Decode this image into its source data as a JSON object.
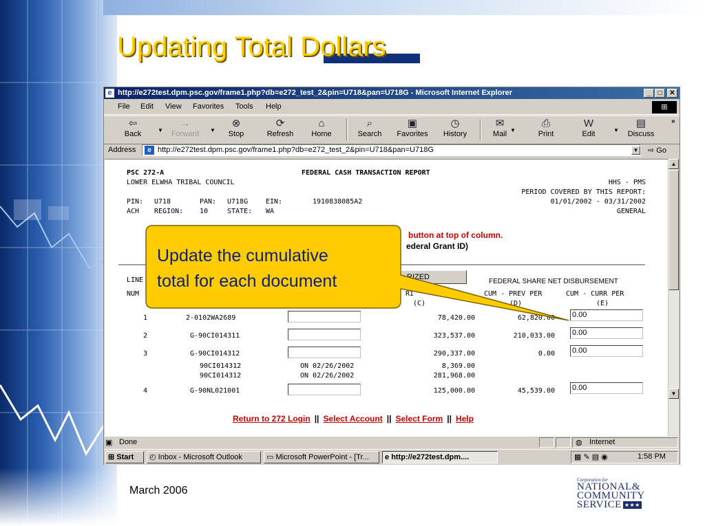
{
  "slide": {
    "title": "Updating Total Dollars",
    "footer_date": "March 2006",
    "logo": {
      "line1": "Corporation for",
      "line2": "NATIONAL&",
      "line3": "COMMUNITY",
      "line4": "SERVICE",
      "stars": "★★★"
    }
  },
  "browser": {
    "title": "http://e272test.dpm.psc.gov/frame1.php?db=e272_test_2&pin=U718&pan=U718G - Microsoft Internet Explorer",
    "menu": [
      "File",
      "Edit",
      "View",
      "Favorites",
      "Tools",
      "Help"
    ],
    "toolbar": [
      "Back",
      "Forward",
      "Stop",
      "Refresh",
      "Home",
      "Search",
      "Favorites",
      "History",
      "Mail",
      "Print",
      "Edit",
      "Discuss"
    ],
    "address_label": "Address",
    "address": "http://e272test.dpm.psc.gov/frame1.php?db=e272_test_2&pin=U718&pan=U718G",
    "go_label": "Go",
    "status_text": "Done",
    "zone": "Internet"
  },
  "report": {
    "form_id": "PSC 272-A",
    "report_title": "FEDERAL CASH TRANSACTION REPORT",
    "org": "LOWER ELWHA TRIBAL COUNCIL",
    "agency": "HHS - PMS",
    "period_label": "PERIOD COVERED BY THIS REPORT:",
    "period": "01/01/2002 - 03/31/2002",
    "pin_label": "PIN:",
    "pin": "U718",
    "pan_label": "PAN:",
    "pan": "U718G",
    "ein_label": "EIN:",
    "ein": "1910838085A2",
    "ach_label": "ACH",
    "region_label": "REGION:",
    "region": "10",
    "state_label": "STATE:",
    "state": "WA",
    "type": "GENERAL",
    "instruction1": "button at top of column.",
    "instruction2": "ederal Grant ID)",
    "authorized_btn": "RIZED",
    "col_line": "LINE",
    "col_num": "NUM",
    "col_fsnd": "FEDERAL SHARE NET DISBURSEMENT",
    "col_c_frag": "RI",
    "col_c": "(C)",
    "col_d_label": "CUM - PREV PER",
    "col_d": "(D)",
    "col_e_label": "CUM - CURR PER",
    "col_e": "(E)",
    "rows": [
      {
        "line": "1",
        "doc": "2-0102WA2689",
        "authorized": "78,420.00",
        "cum_prev": "62,820.00",
        "cum_curr": "0.00"
      },
      {
        "line": "2",
        "doc": "G-90CI014311",
        "authorized": "323,537.00",
        "cum_prev": "210,033.00",
        "cum_curr": "0.00"
      },
      {
        "line": "3",
        "doc": "G-90CI014312",
        "authorized": "290,337.00",
        "cum_prev": "0.00",
        "cum_curr": "0.00"
      },
      {
        "line": "4",
        "doc": "G-90NL021001",
        "authorized": "125,000.00",
        "cum_prev": "45,539.00",
        "cum_curr": "0.00"
      }
    ],
    "subrows": [
      {
        "doc": "90CI014312",
        "date": "ON 02/26/2002",
        "amount": "8,369.00"
      },
      {
        "doc": "90CI014312",
        "date": "ON 02/26/2002",
        "amount": "281,968.00"
      }
    ],
    "links": {
      "return": "Return to 272 Login",
      "select_account": "Select Account",
      "select_form": "Select Form",
      "help": "Help",
      "separator": "||"
    }
  },
  "taskbar": {
    "start": "Start",
    "tasks": [
      "Inbox - Microsoft Outlook",
      "Microsoft PowerPoint - [Tr...",
      "http://e272test.dpm...."
    ],
    "clock": "1:58 PM"
  },
  "callout": {
    "line1": "Update the cumulative",
    "line2": "total for each document"
  }
}
